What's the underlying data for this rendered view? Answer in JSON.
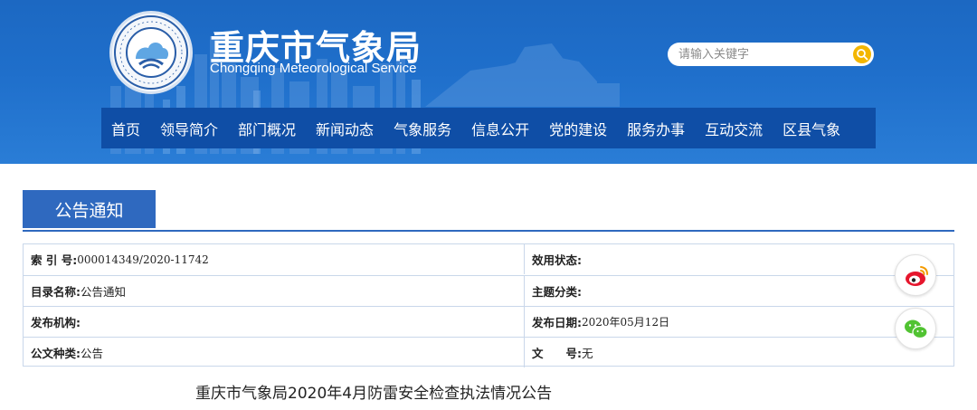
{
  "header": {
    "title": "重庆市气象局",
    "subtitle": "Chongqing Meteorological Service",
    "logo_ring_text": "CHINA METEOROLOGY",
    "logo_top_text": "中国气象"
  },
  "search": {
    "placeholder": "请输入关键字",
    "button_icon": "search-icon"
  },
  "nav": {
    "items": [
      "首页",
      "领导简介",
      "部门概况",
      "新闻动态",
      "气象服务",
      "信息公开",
      "党的建设",
      "服务办事",
      "互动交流",
      "区县气象"
    ]
  },
  "section": {
    "tab_label": "公告通知"
  },
  "meta": {
    "rows": [
      {
        "left_label": "索 引 号: ",
        "left_value": "000014349/2020-11742",
        "right_label": "效用状态:",
        "right_value": ""
      },
      {
        "left_label": "目录名称: ",
        "left_value": "公告通知",
        "right_label": "主题分类:",
        "right_value": ""
      },
      {
        "left_label": "发布机构:",
        "left_value": "",
        "right_label": "发布日期: ",
        "right_value": "2020年05月12日"
      },
      {
        "left_label": "公文种类:",
        "left_value": "公告",
        "right_label": "文　　号:",
        "right_value": "无"
      }
    ]
  },
  "share": {
    "weibo_icon": "weibo-icon",
    "wechat_icon": "wechat-icon"
  },
  "article": {
    "title": "重庆市气象局2020年4月防雷安全检查执法情况公告"
  },
  "colors": {
    "header_blue": "#1f6fcb",
    "nav_blue": "#0f4ea6",
    "tab_blue": "#2f69bf",
    "search_yellow": "#f3b600"
  }
}
